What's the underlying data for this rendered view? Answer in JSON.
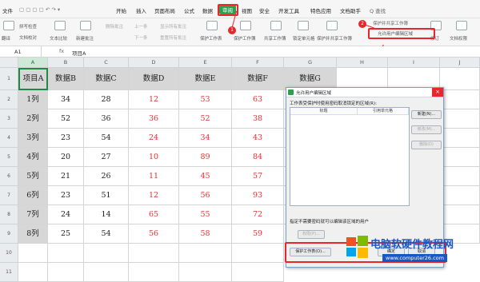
{
  "menubar": {
    "file": "文件",
    "tabs": [
      "开始",
      "插入",
      "页面布局",
      "公式",
      "数据",
      "审阅",
      "视图",
      "安全",
      "开发工具",
      "特色应用",
      "文档助手"
    ],
    "active_tab": "审阅",
    "search": "Q 查找"
  },
  "ribbon": {
    "items": [
      "翻译",
      "拼写检查",
      "文档校对",
      "文本比较",
      "新建批注",
      "删除批注",
      "上一条",
      "下一条",
      "显示所有批注",
      "重置所有批注",
      "保护工作表",
      "保护工作簿",
      "共享工作簿",
      "锁定单元格",
      "保护并共享工作簿",
      "允许用户编辑区域",
      "修订",
      "文档权限"
    ],
    "badge1": "1",
    "badge2": "2",
    "badge3": "3"
  },
  "formulabar": {
    "cell_ref": "A1",
    "fx": "fx",
    "value": "项目A"
  },
  "sheet": {
    "columns": [
      "A",
      "B",
      "C",
      "D",
      "E",
      "F",
      "G",
      "H",
      "I",
      "J"
    ],
    "header_row": [
      "项目A",
      "数据B",
      "数据C",
      "数据D",
      "数据E",
      "数据F",
      "数据G"
    ],
    "row_numbers": [
      "1",
      "2",
      "3",
      "4",
      "5",
      "6",
      "7",
      "8",
      "9",
      "10",
      "11",
      "12"
    ],
    "rows": [
      [
        "1列",
        "34",
        "28",
        "12",
        "53",
        "63"
      ],
      [
        "2列",
        "52",
        "36",
        "36",
        "52",
        "38"
      ],
      [
        "3列",
        "23",
        "54",
        "24",
        "34",
        "43"
      ],
      [
        "4列",
        "20",
        "27",
        "10",
        "89",
        "84"
      ],
      [
        "5列",
        "21",
        "26",
        "11",
        "45",
        "57"
      ],
      [
        "6列",
        "23",
        "51",
        "12",
        "56",
        "93"
      ],
      [
        "7列",
        "24",
        "14",
        "65",
        "55",
        "72"
      ],
      [
        "8列",
        "25",
        "54",
        "56",
        "58",
        "59"
      ]
    ]
  },
  "dialog": {
    "title": "允许用户编辑区域",
    "close": "×",
    "desc": "工作表受保护时使用密码取消锁定的区域(R):",
    "col_title": "标题",
    "col_ref": "引用单元格",
    "btn_new": "新建(N)...",
    "btn_modify": "修改(M)...",
    "btn_delete": "删除(D)",
    "footer_text": "指定不需要密码就可以编辑该区域的用户",
    "btn_perm": "权限(P)...",
    "btn_protect": "保护工作表(O)...",
    "btn_ok": "确定",
    "btn_cancel": "取消"
  },
  "watermark": {
    "name": "电脑软硬件教程网",
    "url": "www.computer26.com"
  },
  "colors": {
    "accent": "#2e9e4f",
    "highlight": "#e8262c",
    "red_text": "#e0302c",
    "gray_fill": "#d7d7d7"
  }
}
